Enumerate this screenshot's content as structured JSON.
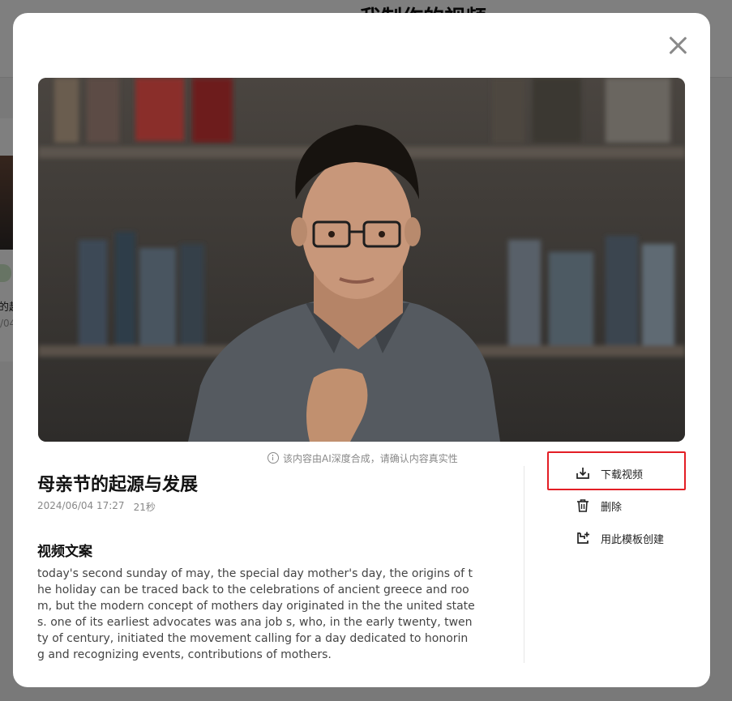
{
  "background": {
    "page_title": "我制作的视频",
    "card_title_fragment": "的起",
    "card_date_fragment": "/04"
  },
  "modal": {
    "close_icon": "close-icon",
    "ai_notice": "该内容由AI深度合成，请确认内容真实性",
    "title": "母亲节的起源与发展",
    "date": "2024/06/04 17:27",
    "duration": "21秒",
    "script_heading": "视频文案",
    "script_body": "today's second sunday of may, the special day mother's day, the origins of the holiday can be traced back to the celebrations of ancient greece and room, but the modern concept of mothers day originated in the the united states. one of its earliest advocates was ana job s, who, in the early twenty, twenty of century, initiated the movement calling for a day dedicated to honoring and recognizing events, contributions of mothers.",
    "actions": [
      {
        "label": "下载视频",
        "icon": "download-icon"
      },
      {
        "label": "删除",
        "icon": "trash-icon"
      },
      {
        "label": "用此模板创建",
        "icon": "create-from-template-icon"
      }
    ],
    "colors": {
      "highlight": "#e31e25",
      "overlay": "rgba(0,0,0,0.5)"
    }
  }
}
